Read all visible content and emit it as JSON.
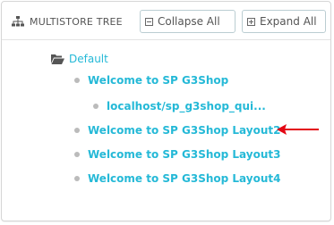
{
  "header": {
    "title": "MULTISTORE TREE",
    "title_icon": "sitemap-icon",
    "collapse_label": "Collapse All",
    "expand_label": "Expand All"
  },
  "tree": {
    "root_label": "Default",
    "root_icon": "folder-open-icon",
    "items": [
      {
        "label": "Welcome to SP G3Shop"
      },
      {
        "label": "localhost/sp_g3shop_qui..."
      },
      {
        "label": "Welcome to SP G3Shop Layout2"
      },
      {
        "label": "Welcome to SP G3Shop Layout3"
      },
      {
        "label": "Welcome to SP G3Shop Layout4"
      }
    ]
  },
  "annotation": {
    "icon": "red-arrow-icon",
    "color": "#e30613"
  },
  "colors": {
    "link": "#25b9d7",
    "text": "#555555",
    "bullet": "#bbbbbb",
    "border": "#d6d6d6"
  }
}
